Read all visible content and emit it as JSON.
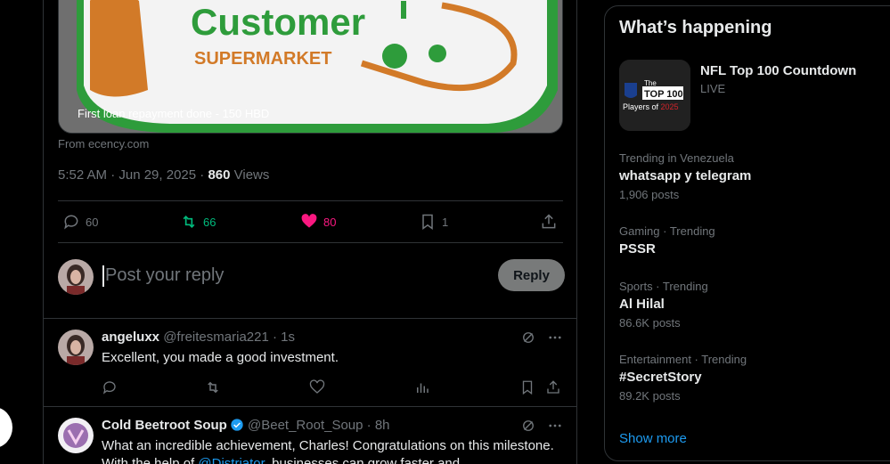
{
  "post": {
    "card_caption": "First loan repayment done - 150 HBD",
    "card_text_customer": "Customer",
    "card_text_supermarket": "SUPERMARKET",
    "from": "From ecency.com",
    "timestamp": "5:52 AM · Jun 29, 2025 · ",
    "views_count": "860",
    "views_label": " Views",
    "replies": "60",
    "reposts": "66",
    "likes": "80",
    "bookmarks": "1",
    "colors": {
      "repost": "#00ba7c",
      "like": "#f91880"
    }
  },
  "reply_box": {
    "placeholder": "Post your reply",
    "button": "Reply"
  },
  "replies": [
    {
      "name": "angeluxx",
      "handle": "@freitesmaria221 · 1s",
      "text": "Excellent, you made a good investment."
    },
    {
      "name": "Cold Beetroot Soup",
      "handle": "@Beet_Root_Soup · 8h",
      "text_before": "What an incredible achievement, Charles! Congratulations on this milestone. With the help of ",
      "mention": "@Distriator",
      "text_after": ", businesses can grow faster and"
    }
  ],
  "sidebar": {
    "title": "What’s happening",
    "featured": {
      "title": "NFL Top 100 Countdown",
      "sub": "LIVE",
      "thumb_the": "The",
      "thumb_top": "TOP 100",
      "thumb_players": "Players of ",
      "thumb_year": "2025"
    },
    "trends": [
      {
        "context": "Trending in Venezuela",
        "topic": "whatsapp y telegram",
        "posts": "1,906 posts"
      },
      {
        "context": "Gaming · Trending",
        "topic": "PSSR",
        "posts": ""
      },
      {
        "context": "Sports · Trending",
        "topic": "Al Hilal",
        "posts": "86.6K posts"
      },
      {
        "context": "Entertainment · Trending",
        "topic": "#SecretStory",
        "posts": "89.2K posts"
      }
    ],
    "show_more": "Show more"
  }
}
